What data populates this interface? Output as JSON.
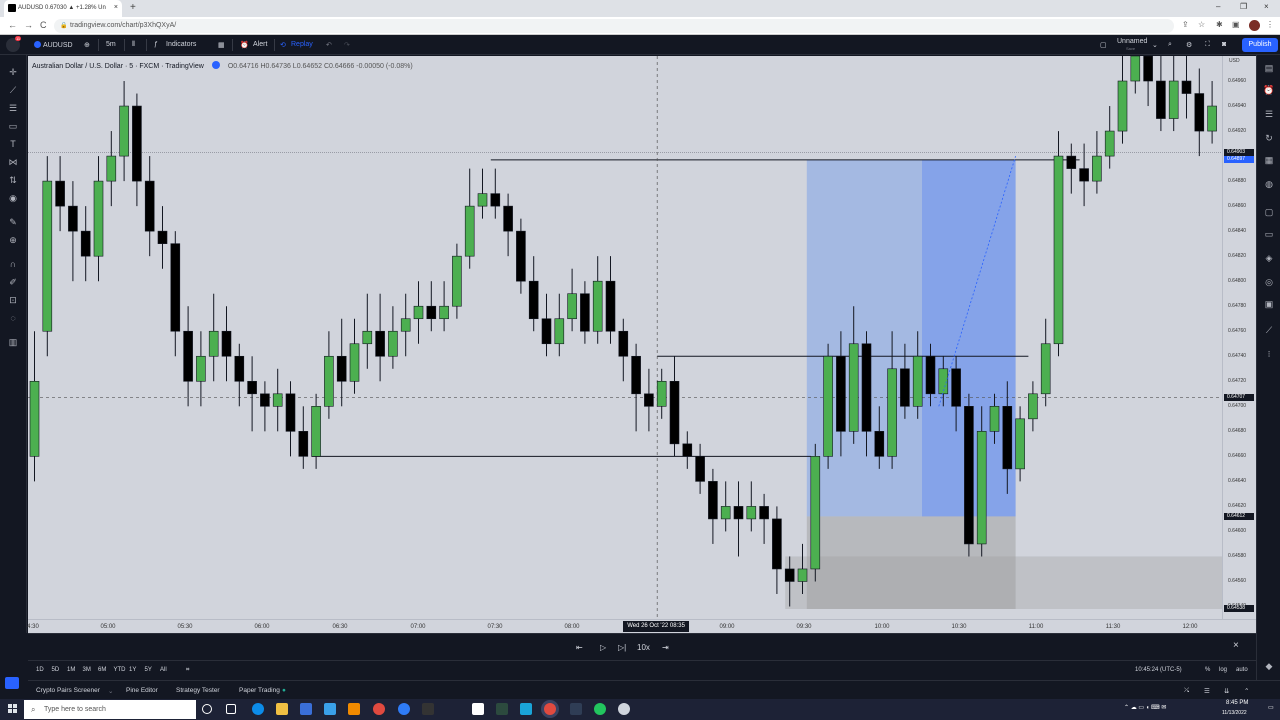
{
  "browser": {
    "tab_title": "AUDUSD 0.67030 ▲ +1.28% Un",
    "tab_close": "×",
    "new_tab": "+",
    "url": "tradingview.com/chart/p3XhQXyA/",
    "back": "←",
    "forward": "→",
    "reload": "C",
    "minimize": "–",
    "restore": "❐",
    "close": "×"
  },
  "toolbar": {
    "symbol": "AUDUSD",
    "interval": "5m",
    "indicators": "Indicators",
    "alert": "Alert",
    "replay": "Replay",
    "layout_name": "Unnamed",
    "layout_sub": "Save",
    "publish": "Publish"
  },
  "legend": {
    "title": "Australian Dollar / U.S. Dollar · 5 · FXCM · TradingView",
    "ohlc": "O0.64716  H0.64736  L0.64652  C0.64666  -0.00050 (-0.08%)"
  },
  "price_axis": {
    "currency": "USD",
    "labels": [
      "0.64960",
      "0.64940",
      "0.64920",
      "0.64900",
      "0.64880",
      "0.64860",
      "0.64840",
      "0.64820",
      "0.64800",
      "0.64780",
      "0.64760",
      "0.64740",
      "0.64720",
      "0.64700",
      "0.64680",
      "0.64660",
      "0.64640",
      "0.64620",
      "0.64600",
      "0.64580",
      "0.64560",
      "0.64540"
    ],
    "tags": [
      {
        "text": "0.64903",
        "color": "#131722"
      },
      {
        "text": "0.64897",
        "color": "#2962ff"
      },
      {
        "text": "0.64707",
        "color": "#131722"
      },
      {
        "text": "0.64612",
        "color": "#131722"
      },
      {
        "text": "0.64538",
        "color": "#131722"
      }
    ]
  },
  "time_axis": {
    "labels": [
      "4:30",
      "05:00",
      "05:30",
      "06:00",
      "06:30",
      "07:00",
      "07:30",
      "08:00",
      "09:00",
      "09:30",
      "10:00",
      "10:30",
      "11:00",
      "11:30",
      "12:00"
    ],
    "crosshair": "Wed 26 Oct '22   08:35"
  },
  "replay": {
    "speed": "10x"
  },
  "ranges": {
    "items": [
      "1D",
      "5D",
      "1M",
      "3M",
      "6M",
      "YTD",
      "1Y",
      "5Y",
      "All"
    ],
    "clock": "10:45:24 (UTC-5)",
    "percent": "%",
    "log": "log",
    "auto": "auto"
  },
  "panel_tabs": [
    "Crypto Pairs Screener",
    "Pine Editor",
    "Strategy Tester",
    "Paper Trading"
  ],
  "taskbar": {
    "search_placeholder": "Type here to search",
    "time": "8:45 PM",
    "date": "11/13/2022"
  },
  "chart_data": {
    "type": "candlestick",
    "symbol": "AUDUSD",
    "timeframe": "5",
    "ylim": [
      0.6453,
      0.6498
    ],
    "colors": {
      "up": "#4caf50",
      "down": "#000000",
      "position_profit": "#7fa3e8",
      "position_loss": "#9e9e9e"
    },
    "candles": [
      [
        0.6466,
        0.6472,
        0.6464,
        0.6476
      ],
      [
        0.6476,
        0.6488,
        0.6474,
        0.649
      ],
      [
        0.6488,
        0.6486,
        0.6484,
        0.649
      ],
      [
        0.6486,
        0.6484,
        0.648,
        0.6488
      ],
      [
        0.6484,
        0.6482,
        0.648,
        0.6486
      ],
      [
        0.6482,
        0.6488,
        0.648,
        0.649
      ],
      [
        0.6488,
        0.649,
        0.6486,
        0.6492
      ],
      [
        0.649,
        0.6494,
        0.6488,
        0.6496
      ],
      [
        0.6494,
        0.6488,
        0.6486,
        0.6495
      ],
      [
        0.6488,
        0.6484,
        0.6482,
        0.649
      ],
      [
        0.6484,
        0.6483,
        0.6481,
        0.6486
      ],
      [
        0.6483,
        0.6476,
        0.6474,
        0.6484
      ],
      [
        0.6476,
        0.6472,
        0.647,
        0.6478
      ],
      [
        0.6472,
        0.6474,
        0.647,
        0.6476
      ],
      [
        0.6474,
        0.6476,
        0.6472,
        0.6479
      ],
      [
        0.6476,
        0.6474,
        0.6472,
        0.6478
      ],
      [
        0.6474,
        0.6472,
        0.647,
        0.6475
      ],
      [
        0.6472,
        0.6471,
        0.6468,
        0.6474
      ],
      [
        0.6471,
        0.647,
        0.6468,
        0.6472
      ],
      [
        0.647,
        0.6471,
        0.6468,
        0.6473
      ],
      [
        0.6471,
        0.6468,
        0.6466,
        0.6472
      ],
      [
        0.6468,
        0.6466,
        0.6465,
        0.647
      ],
      [
        0.6466,
        0.647,
        0.6465,
        0.6471
      ],
      [
        0.647,
        0.6474,
        0.6469,
        0.6476
      ],
      [
        0.6474,
        0.6472,
        0.647,
        0.6477
      ],
      [
        0.6472,
        0.6475,
        0.6471,
        0.6477
      ],
      [
        0.6475,
        0.6476,
        0.6473,
        0.6479
      ],
      [
        0.6476,
        0.6474,
        0.6472,
        0.6479
      ],
      [
        0.6474,
        0.6476,
        0.6473,
        0.6478
      ],
      [
        0.6476,
        0.6477,
        0.6474,
        0.6479
      ],
      [
        0.6477,
        0.6478,
        0.6475,
        0.648
      ],
      [
        0.6478,
        0.6477,
        0.6476,
        0.648
      ],
      [
        0.6477,
        0.6478,
        0.6476,
        0.648
      ],
      [
        0.6478,
        0.6482,
        0.6477,
        0.6483
      ],
      [
        0.6482,
        0.6486,
        0.6481,
        0.6489
      ],
      [
        0.6486,
        0.6487,
        0.6485,
        0.6489
      ],
      [
        0.6487,
        0.6486,
        0.6485,
        0.6489
      ],
      [
        0.6486,
        0.6484,
        0.6482,
        0.6487
      ],
      [
        0.6484,
        0.648,
        0.6479,
        0.6485
      ],
      [
        0.648,
        0.6477,
        0.6476,
        0.6482
      ],
      [
        0.6477,
        0.6475,
        0.6474,
        0.6479
      ],
      [
        0.6475,
        0.6477,
        0.6474,
        0.6479
      ],
      [
        0.6477,
        0.6479,
        0.6476,
        0.6481
      ],
      [
        0.6479,
        0.6476,
        0.6475,
        0.648
      ],
      [
        0.6476,
        0.648,
        0.6475,
        0.6482
      ],
      [
        0.648,
        0.6476,
        0.6475,
        0.6482
      ],
      [
        0.6476,
        0.6474,
        0.6472,
        0.6477
      ],
      [
        0.6474,
        0.6471,
        0.6468,
        0.6475
      ],
      [
        0.6471,
        0.647,
        0.6468,
        0.6473
      ],
      [
        0.647,
        0.6472,
        0.6469,
        0.6473
      ],
      [
        0.6472,
        0.6467,
        0.6466,
        0.6474
      ],
      [
        0.6467,
        0.6466,
        0.6465,
        0.6468
      ],
      [
        0.6466,
        0.6464,
        0.6463,
        0.6467
      ],
      [
        0.6464,
        0.6461,
        0.6459,
        0.6465
      ],
      [
        0.6461,
        0.6462,
        0.646,
        0.6464
      ],
      [
        0.6462,
        0.6461,
        0.6458,
        0.6464
      ],
      [
        0.6461,
        0.6462,
        0.646,
        0.6464
      ],
      [
        0.6462,
        0.6461,
        0.6459,
        0.6463
      ],
      [
        0.6461,
        0.6457,
        0.6455,
        0.6462
      ],
      [
        0.6457,
        0.6456,
        0.6454,
        0.6458
      ],
      [
        0.6456,
        0.6457,
        0.6455,
        0.6459
      ],
      [
        0.6457,
        0.6466,
        0.6456,
        0.6467
      ],
      [
        0.6466,
        0.6474,
        0.6465,
        0.6475
      ],
      [
        0.6474,
        0.6468,
        0.6466,
        0.6476
      ],
      [
        0.6468,
        0.6475,
        0.6467,
        0.6478
      ],
      [
        0.6475,
        0.6468,
        0.6466,
        0.6476
      ],
      [
        0.6468,
        0.6466,
        0.6465,
        0.647
      ],
      [
        0.6466,
        0.6473,
        0.6465,
        0.6476
      ],
      [
        0.6473,
        0.647,
        0.6469,
        0.6475
      ],
      [
        0.647,
        0.6474,
        0.6469,
        0.6476
      ],
      [
        0.6474,
        0.6471,
        0.647,
        0.6475
      ],
      [
        0.6471,
        0.6473,
        0.647,
        0.6474
      ],
      [
        0.6473,
        0.647,
        0.6468,
        0.6474
      ],
      [
        0.647,
        0.6459,
        0.6458,
        0.6471
      ],
      [
        0.6459,
        0.6468,
        0.6458,
        0.647
      ],
      [
        0.6468,
        0.647,
        0.6467,
        0.6471
      ],
      [
        0.647,
        0.6465,
        0.6463,
        0.6472
      ],
      [
        0.6465,
        0.6469,
        0.6464,
        0.647
      ],
      [
        0.6469,
        0.6471,
        0.6468,
        0.6472
      ],
      [
        0.6471,
        0.6475,
        0.647,
        0.6477
      ],
      [
        0.6475,
        0.649,
        0.6474,
        0.6492
      ],
      [
        0.649,
        0.6489,
        0.6487,
        0.6491
      ],
      [
        0.6489,
        0.6488,
        0.6486,
        0.6491
      ],
      [
        0.6488,
        0.649,
        0.6487,
        0.6492
      ],
      [
        0.649,
        0.6492,
        0.6489,
        0.6494
      ],
      [
        0.6492,
        0.6496,
        0.6491,
        0.6498
      ],
      [
        0.6496,
        0.6498,
        0.6495,
        0.6499
      ],
      [
        0.6498,
        0.6496,
        0.6494,
        0.6499
      ],
      [
        0.6496,
        0.6493,
        0.6492,
        0.6498
      ],
      [
        0.6493,
        0.6496,
        0.6492,
        0.6498
      ],
      [
        0.6496,
        0.6495,
        0.6493,
        0.6498
      ],
      [
        0.6495,
        0.6492,
        0.649,
        0.6497
      ],
      [
        0.6492,
        0.6494,
        0.6491,
        0.6496
      ]
    ],
    "levels": [
      0.64897,
      0.6474,
      0.6466
    ],
    "crosshair_price": 0.64707,
    "position": {
      "entry": 0.64612,
      "target": 0.64897,
      "stop": 0.64538
    }
  }
}
